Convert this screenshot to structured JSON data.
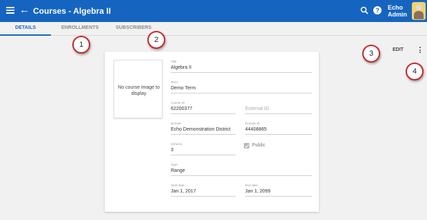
{
  "header": {
    "title": "Courses - Algebra II",
    "user_line1": "Echo",
    "user_line2": "Admin",
    "help_label": "?"
  },
  "tabs": [
    {
      "label": "DETAILS",
      "active": true
    },
    {
      "label": "ENROLLMENTS",
      "active": false
    },
    {
      "label": "SUBSCRIBERS",
      "active": false
    }
  ],
  "actions": {
    "edit_label": "EDIT"
  },
  "course": {
    "image_placeholder": "No course image to display",
    "title": {
      "label": "Title",
      "value": "Algebra II"
    },
    "term": {
      "label": "Term",
      "value": "Demo Term"
    },
    "course_id": {
      "label": "Course ID",
      "value": "62200377"
    },
    "external_id": {
      "placeholder": "External ID"
    },
    "domain": {
      "label": "Domain",
      "value": "Echo Demonstration District"
    },
    "domain_id": {
      "label": "Domain ID",
      "value": "44408865"
    },
    "schema": {
      "label": "Schema",
      "value": "3"
    },
    "public": {
      "label": "Public",
      "checked": true
    },
    "type": {
      "label": "Type",
      "value": "Range"
    },
    "start_date": {
      "label": "Start date",
      "value": "Jan 1, 2017"
    },
    "end_date": {
      "label": "End date",
      "value": "Jan 1, 2099"
    }
  },
  "callouts": [
    "1",
    "2",
    "3",
    "4"
  ],
  "colors": {
    "primary": "#1565c0",
    "callout_border": "#c62828"
  }
}
